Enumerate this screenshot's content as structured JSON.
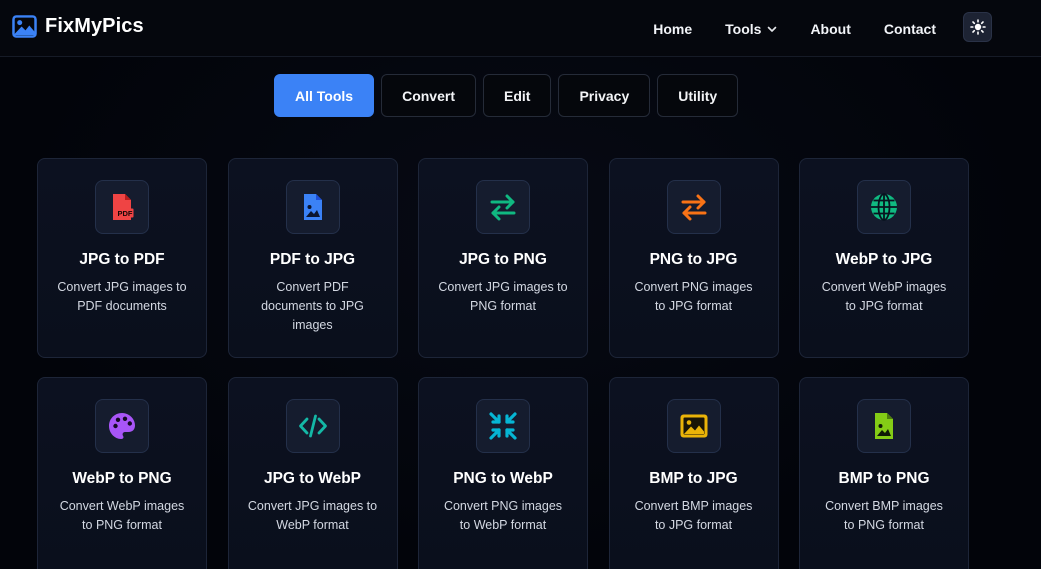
{
  "brand": {
    "name": "FixMyPics",
    "icon": "image-icon",
    "color": "#3b82f6"
  },
  "nav": {
    "links": [
      {
        "label": "Home"
      },
      {
        "label": "Tools",
        "has_dropdown": true
      },
      {
        "label": "About"
      },
      {
        "label": "Contact"
      }
    ],
    "theme_toggle_icon": "sun-icon"
  },
  "filters": [
    {
      "label": "All Tools",
      "active": true
    },
    {
      "label": "Convert",
      "active": false
    },
    {
      "label": "Edit",
      "active": false
    },
    {
      "label": "Privacy",
      "active": false
    },
    {
      "label": "Utility",
      "active": false
    }
  ],
  "tools": [
    {
      "title": "JPG to PDF",
      "description": "Convert JPG images to PDF documents",
      "icon": "file-pdf-icon",
      "color": "#ef4444"
    },
    {
      "title": "PDF to JPG",
      "description": "Convert PDF documents to JPG images",
      "icon": "file-image-icon",
      "color": "#3b82f6"
    },
    {
      "title": "JPG to PNG",
      "description": "Convert JPG images to PNG format",
      "icon": "exchange-arrows-icon",
      "color": "#10b981"
    },
    {
      "title": "PNG to JPG",
      "description": "Convert PNG images to JPG format",
      "icon": "exchange-arrows-icon",
      "color": "#f97316"
    },
    {
      "title": "WebP to JPG",
      "description": "Convert WebP images to JPG format",
      "icon": "globe-icon",
      "color": "#10b981"
    },
    {
      "title": "WebP to PNG",
      "description": "Convert WebP images to PNG format",
      "icon": "palette-icon",
      "color": "#a855f7"
    },
    {
      "title": "JPG to WebP",
      "description": "Convert JPG images to WebP format",
      "icon": "code-icon",
      "color": "#14b8a6"
    },
    {
      "title": "PNG to WebP",
      "description": "Convert PNG images to WebP format",
      "icon": "compress-icon",
      "color": "#06b6d4"
    },
    {
      "title": "BMP to JPG",
      "description": "Convert BMP images to JPG format",
      "icon": "image-icon",
      "color": "#eab308"
    },
    {
      "title": "BMP to PNG",
      "description": "Convert BMP images to PNG format",
      "icon": "file-image-icon",
      "color": "#84cc16"
    }
  ]
}
